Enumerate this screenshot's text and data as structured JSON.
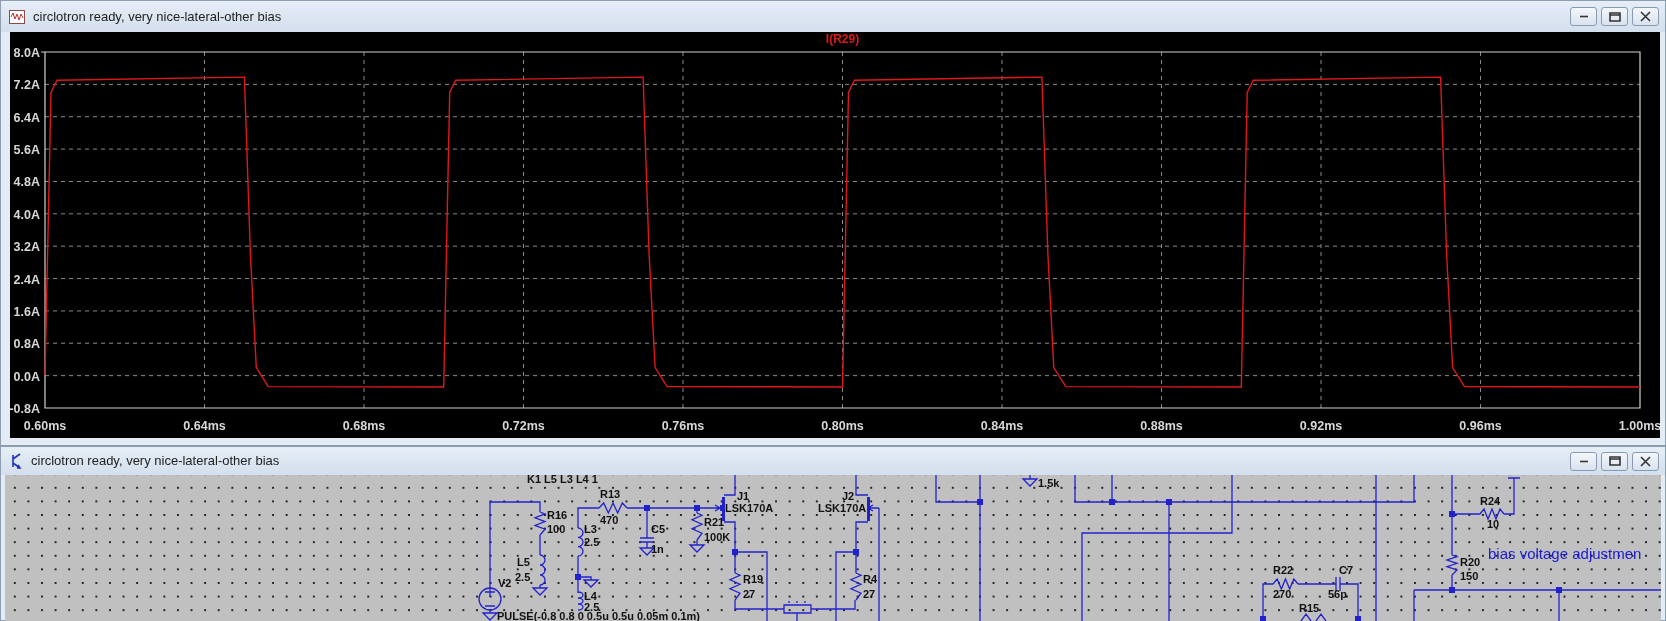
{
  "plot_window": {
    "title": "circlotron ready, very nice-lateral-other bias",
    "chart_data": {
      "type": "line",
      "grid": true,
      "x": [
        0.6,
        0.6015,
        0.603,
        0.65,
        0.6515,
        0.653,
        0.656,
        0.7,
        0.7015,
        0.703,
        0.75,
        0.7515,
        0.753,
        0.756,
        0.8,
        0.8015,
        0.803,
        0.85,
        0.8515,
        0.853,
        0.856,
        0.9,
        0.9015,
        0.903,
        0.95,
        0.9515,
        0.953,
        0.956,
        1.0
      ],
      "series": [
        {
          "name": "I(R29)",
          "color": "#e01818",
          "values": [
            0,
            7.0,
            7.3,
            7.38,
            3.0,
            0.2,
            -0.27,
            -0.28,
            7.0,
            7.3,
            7.38,
            3.0,
            0.2,
            -0.27,
            -0.28,
            7.0,
            7.3,
            7.38,
            3.0,
            0.2,
            -0.27,
            -0.28,
            7.0,
            7.3,
            7.38,
            3.0,
            0.2,
            -0.27,
            -0.28
          ]
        }
      ],
      "xlim": [
        0.6,
        1.0
      ],
      "ylim": [
        -0.8,
        8.0
      ],
      "xticks": [
        {
          "value": 0.6,
          "label": "0.60ms"
        },
        {
          "value": 0.64,
          "label": "0.64ms"
        },
        {
          "value": 0.68,
          "label": "0.68ms"
        },
        {
          "value": 0.72,
          "label": "0.72ms"
        },
        {
          "value": 0.76,
          "label": "0.76ms"
        },
        {
          "value": 0.8,
          "label": "0.80ms"
        },
        {
          "value": 0.84,
          "label": "0.84ms"
        },
        {
          "value": 0.88,
          "label": "0.88ms"
        },
        {
          "value": 0.92,
          "label": "0.92ms"
        },
        {
          "value": 0.96,
          "label": "0.96ms"
        },
        {
          "value": 1.0,
          "label": "1.00ms"
        }
      ],
      "yticks": [
        {
          "value": 8.0,
          "label": "8.0A"
        },
        {
          "value": 7.2,
          "label": "7.2A"
        },
        {
          "value": 6.4,
          "label": "6.4A"
        },
        {
          "value": 5.6,
          "label": "5.6A"
        },
        {
          "value": 4.8,
          "label": "4.8A"
        },
        {
          "value": 4.0,
          "label": "4.0A"
        },
        {
          "value": 3.2,
          "label": "3.2A"
        },
        {
          "value": 2.4,
          "label": "2.4A"
        },
        {
          "value": 1.6,
          "label": "1.6A"
        },
        {
          "value": 0.8,
          "label": "0.8A"
        },
        {
          "value": 0.0,
          "label": "0.0A"
        },
        {
          "value": -0.8,
          "label": "-0.8A"
        }
      ]
    }
  },
  "schematic_window": {
    "title": "circlotron ready, very nice-lateral-other bias",
    "labels": [
      "K1 L5 L3 L4 1",
      "R16",
      "100",
      "L5",
      "2.5",
      "V2",
      "PULSE(-0.8 0.8 0 0.5u 0.5u 0.05m 0.1m)",
      "R13",
      "470",
      "L3",
      "2.5",
      "C5",
      "1n",
      "L4",
      "2.5",
      "R21",
      "100K",
      "J1",
      "LSK170A",
      "J2",
      "LSK170A",
      "R19",
      "27",
      "R4",
      "27",
      "1.5k",
      "R24",
      "10",
      "R20",
      "150",
      "R22",
      "270",
      "C7",
      "56p",
      "R15"
    ],
    "note": "bias voltage adjustmen"
  }
}
